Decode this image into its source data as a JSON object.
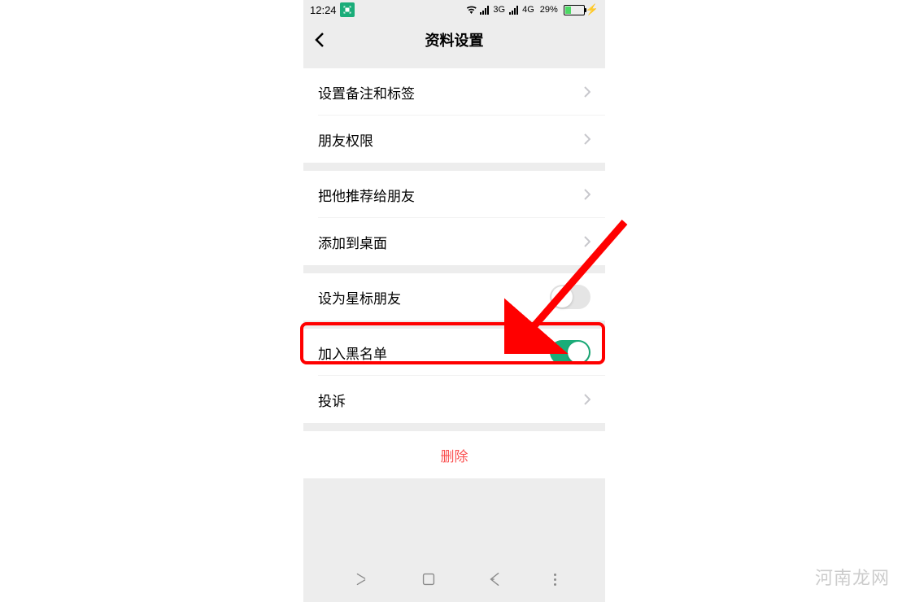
{
  "statusBar": {
    "time": "12:24",
    "network1": "3G",
    "network2": "4G",
    "batteryPercent": "29%"
  },
  "header": {
    "title": "资料设置"
  },
  "sections": {
    "group1": {
      "item1": "设置备注和标签",
      "item2": "朋友权限"
    },
    "group2": {
      "item1": "把他推荐给朋友",
      "item2": "添加到桌面"
    },
    "group3": {
      "item1": "设为星标朋友"
    },
    "group4": {
      "item1": "加入黑名单",
      "item2": "投诉"
    }
  },
  "deleteButton": "删除",
  "watermark": "河南龙网",
  "toggles": {
    "starFriend": false,
    "blacklist": true
  }
}
